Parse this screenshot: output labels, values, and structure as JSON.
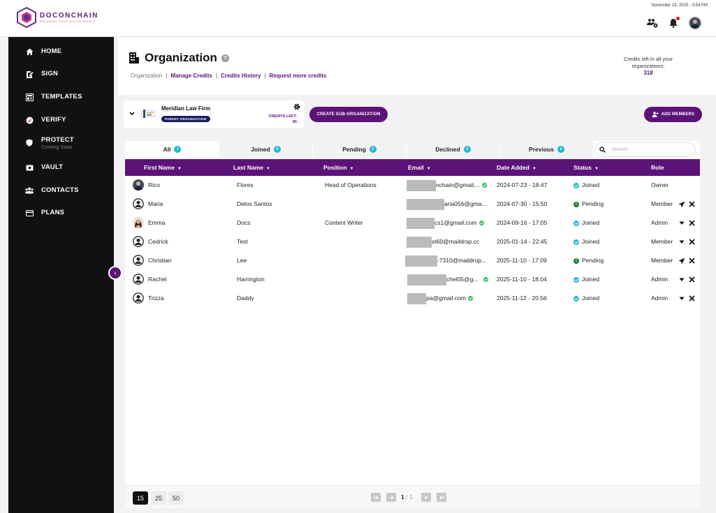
{
  "app": {
    "logo_name": "DOCONCHAIN",
    "logo_tagline": "SECURING YOUR DIGITAL WORLD",
    "datetime": "November 23, 2025 - 3:54 PM",
    "accent": "#5c1377"
  },
  "sidebar": {
    "items": [
      {
        "label": "HOME",
        "icon": "home-icon"
      },
      {
        "label": "SIGN",
        "icon": "sign-icon"
      },
      {
        "label": "TEMPLATES",
        "icon": "templates-icon"
      },
      {
        "label": "VERIFY",
        "icon": "verify-icon"
      },
      {
        "label": "PROTECT",
        "sub": "Coming Soon",
        "icon": "shield-icon"
      },
      {
        "label": "VAULT",
        "icon": "vault-icon"
      },
      {
        "label": "CONTACTS",
        "icon": "contacts-icon"
      },
      {
        "label": "PLANS",
        "icon": "plans-icon"
      }
    ]
  },
  "header": {
    "title": "Organization",
    "breadcrumb": {
      "current": "Organization",
      "links": [
        "Manage Credits",
        "Credits History",
        "Request more credits"
      ]
    },
    "credits_label": "Credits left in all your organizations:",
    "credits_value": "318"
  },
  "org": {
    "name": "Meridian Law Firm",
    "badge": "PARENT ORGANIZATION",
    "credits_label": "CREDITS LEFT:",
    "credits_value": "85"
  },
  "actions": {
    "create_sub": "CREATE SUB-ORGANIZATION",
    "add_members": "ADD MEMBERS"
  },
  "tabs": [
    {
      "label": "All",
      "count": "7"
    },
    {
      "label": "Joined",
      "count": "5"
    },
    {
      "label": "Pending",
      "count": "2"
    },
    {
      "label": "Declined",
      "count": "0"
    },
    {
      "label": "Previous",
      "count": "0"
    }
  ],
  "search": {
    "placeholder": "Search"
  },
  "columns": [
    "First Name",
    "Last Name",
    "Position",
    "Email",
    "Date Added",
    "Status",
    "Role"
  ],
  "rows": [
    {
      "first": "Rico",
      "last": "Flores",
      "position": "Head of Operations",
      "email": "nchain@gmail....",
      "date": "2024-07-23 - 18:47",
      "status": "Joined",
      "role": "Owner"
    },
    {
      "first": "Maria",
      "last": "Delos Santos",
      "position": "",
      "email": "aria056@gma...",
      "date": "2024-07-30 - 15:50",
      "status": "Pending",
      "role": "Member"
    },
    {
      "first": "Emma",
      "last": "Docs",
      "position": "Content Writer",
      "email": "cs1@gmail.com",
      "date": "2024-09-16 - 17:05",
      "status": "Joined",
      "role": "Admin"
    },
    {
      "first": "Cedrick",
      "last": "Test",
      "position": "",
      "email": "st60@maildrop.cc",
      "date": "2025-01-14 - 22:45",
      "status": "Joined",
      "role": "Member"
    },
    {
      "first": "Christian",
      "last": "Lee",
      "position": "",
      "email": "-7310@maildrop...",
      "date": "2025-11-10 - 17:09",
      "status": "Pending",
      "role": "Member"
    },
    {
      "first": "Rachel",
      "last": "Harrington",
      "position": "",
      "email": "chel05@g...",
      "date": "2025-11-10 - 18:04",
      "status": "Joined",
      "role": "Admin"
    },
    {
      "first": "Trizza",
      "last": "Daddy",
      "position": "",
      "email": "pa@gmail.com",
      "date": "2025-11-12 - 20:56",
      "status": "Joined",
      "role": "Admin"
    }
  ],
  "pagination": {
    "sizes": [
      "15",
      "25",
      "50"
    ],
    "current_page": "1",
    "total_pages": "/ 1"
  }
}
